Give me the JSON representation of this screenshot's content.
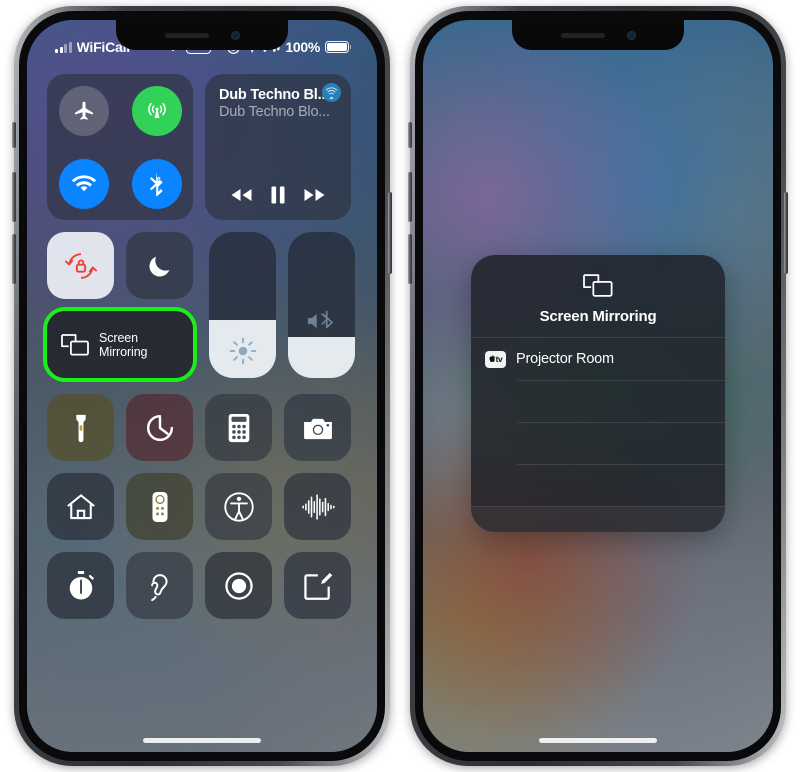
{
  "phones": [
    {
      "id": "control-center",
      "status_bar": {
        "signal_icon": "cellular-bars-icon",
        "carrier": "WiFiCall",
        "wifi_icon": "wifi-icon",
        "vpn_badge": "VPN",
        "rotation_lock_icon": "rotation-lock-icon",
        "location_icon": "location-arrow-icon",
        "headphones_icon": "headphones-battery-icon",
        "battery_percent": "100%",
        "battery_icon": "battery-full-icon"
      },
      "control_center": {
        "connectivity": {
          "airplane": {
            "name": "airplane-mode-toggle",
            "icon": "airplane-icon",
            "state": "off"
          },
          "cellular": {
            "name": "cellular-data-toggle",
            "icon": "cellular-antenna-icon",
            "state": "on"
          },
          "wifi": {
            "name": "wifi-toggle",
            "icon": "wifi-icon",
            "state": "on"
          },
          "bluetooth": {
            "name": "bluetooth-toggle",
            "icon": "bluetooth-icon",
            "state": "on"
          }
        },
        "media": {
          "track_title": "Dub Techno Bl...",
          "track_artist": "Dub Techno Blo...",
          "airplay_icon": "airplay-audio-icon",
          "rewind_icon": "rewind-icon",
          "pause_icon": "pause-icon",
          "forward_icon": "fast-forward-icon"
        },
        "rotation_lock": {
          "label": "rotation-lock-toggle",
          "icon": "rotation-lock-icon",
          "state": "on"
        },
        "do_not_disturb": {
          "label": "do-not-disturb-toggle",
          "icon": "moon-icon",
          "state": "off"
        },
        "screen_mirroring": {
          "label_line1": "Screen",
          "label_line2": "Mirroring",
          "icon": "screen-mirroring-icon",
          "highlighted": true,
          "highlight_color": "#19ef19"
        },
        "brightness": {
          "name": "brightness-slider",
          "icon": "brightness-icon",
          "level_percent": 40
        },
        "volume": {
          "name": "volume-slider",
          "icon": "volume-bluetooth-icon",
          "level_percent": 28
        },
        "apps": [
          [
            {
              "name": "flashlight-button",
              "icon": "flashlight-icon",
              "tint": "tint-yellow"
            },
            {
              "name": "timer-button",
              "icon": "timer-icon",
              "tint": "tint-red"
            },
            {
              "name": "calculator-button",
              "icon": "calculator-icon",
              "tint": "tint-gray"
            },
            {
              "name": "camera-button",
              "icon": "camera-icon",
              "tint": "tint-blue"
            }
          ],
          [
            {
              "name": "home-button",
              "icon": "home-icon",
              "tint": "tint-dark"
            },
            {
              "name": "apple-tv-remote-button",
              "icon": "tv-remote-icon",
              "tint": "tint-olive"
            },
            {
              "name": "accessibility-button",
              "icon": "accessibility-icon",
              "tint": "tint-gray"
            },
            {
              "name": "sound-recognition-button",
              "icon": "sound-wave-icon",
              "tint": "tint-navy"
            }
          ],
          [
            {
              "name": "stopwatch-button",
              "icon": "stopwatch-icon",
              "tint": "tint-dark"
            },
            {
              "name": "hearing-button",
              "icon": "ear-icon",
              "tint": "tint-gray"
            },
            {
              "name": "screen-recording-button",
              "icon": "record-icon",
              "tint": "tint-dark"
            },
            {
              "name": "notes-button",
              "icon": "notes-pencil-icon",
              "tint": "tint-navy"
            }
          ]
        ]
      }
    },
    {
      "id": "screen-mirroring-panel",
      "panel": {
        "icon": "screen-mirroring-icon",
        "title": "Screen Mirroring",
        "devices": [
          {
            "name": "Projector Room",
            "icon": "apple-tv-icon",
            "icon_text": "tv"
          }
        ],
        "empty_row_count": 3
      }
    }
  ],
  "colors": {
    "highlight_green": "#19ef19",
    "toggle_blue": "#0a84ff",
    "toggle_green": "#32d158",
    "rotation_lock_red": "#ef4036"
  }
}
